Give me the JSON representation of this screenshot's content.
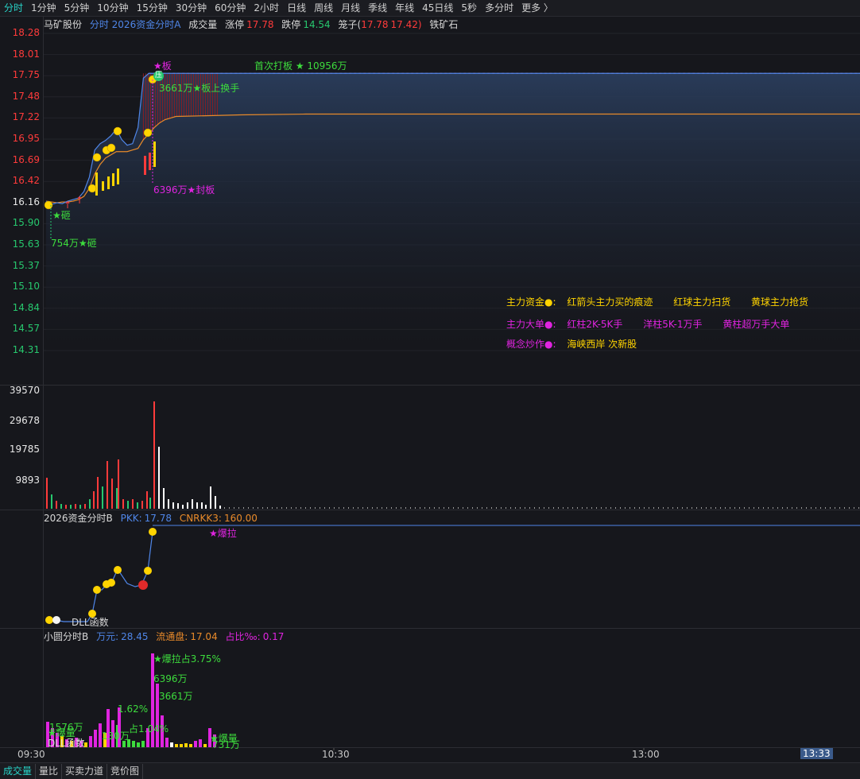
{
  "tabs": [
    "分时",
    "1分钟",
    "5分钟",
    "10分钟",
    "15分钟",
    "30分钟",
    "60分钟",
    "2小时",
    "日线",
    "周线",
    "月线",
    "季线",
    "年线",
    "45日线",
    "5秒",
    "多分时",
    "更多 〉"
  ],
  "active_tab": 0,
  "header": {
    "stock": "马矿股份",
    "indicator": "分时 2026资金分时A",
    "volume_label": "成交量",
    "limit_up_label": "涨停",
    "limit_up": "17.78",
    "limit_down_label": "跌停",
    "limit_down": "14.54",
    "cage_label": "笼子(",
    "cage_hi": "17.78",
    "cage_lo": "17.42)",
    "sector": "铁矿石"
  },
  "price_axis": [
    "18.28",
    "18.01",
    "17.75",
    "17.48",
    "17.22",
    "16.95",
    "16.69",
    "16.42",
    "16.16",
    "15.90",
    "15.63",
    "15.37",
    "15.10",
    "14.84",
    "14.57",
    "14.31"
  ],
  "volume_axis": [
    "39570",
    "29678",
    "19785",
    "9893"
  ],
  "indicator_b": {
    "name": "2026资金分时B",
    "pkk_label": "PKK:",
    "pkk": "17.78",
    "cnrkk_label": "CNRKK3:",
    "cnrkk": "160.00",
    "burst": "★爆拉",
    "func_label": "DLL函数"
  },
  "indicator_c": {
    "name": "小圆分时B",
    "wan_label": "万元:",
    "wan": "28.45",
    "float_label": "流通盘:",
    "float": "17.04",
    "ratio_label": "占比‰:",
    "ratio": "0.17",
    "ann_burst": "★爆拉占3.75%",
    "ann_6396": "6396万",
    "ann_3661": "3661万",
    "ann_162": "1.62%",
    "ann_pct104": "占1.04%",
    "ann_1576": "1576万",
    "ann_boom1": "★爆量",
    "ann_boom2": "★爆量",
    "ann_731": "731万",
    "ann_dll": "DLL函数",
    "ann_130": "130万"
  },
  "annotations": {
    "limit_star": "★板",
    "first_board": "首次打板 ★ 10956万",
    "turnover": "3661万★板上换手",
    "seal": "6396万★封板",
    "smash": "★砸",
    "smash_amt": "754万★砸",
    "badge": "压"
  },
  "legend": {
    "row1_title": "主力资金●:",
    "row1_items": [
      "红箭头主力买的痕迹",
      "红球主力扫货",
      "黄球主力抢货"
    ],
    "row2_title": "主力大单●:",
    "row2_items": [
      "红柱2K-5K手",
      "洋柱5K-1万手",
      "黄柱超万手大单"
    ],
    "row3_title": "概念炒作●:",
    "row3_items": [
      "海峡西岸 次新股"
    ]
  },
  "time_axis": [
    "09:30",
    "10:30",
    "13:00"
  ],
  "current_time": "13:33",
  "bottom_tabs": [
    "成交量",
    "量比",
    "买卖力道",
    "竞价图"
  ],
  "colors": {
    "up": "#ff3b3b",
    "down": "#27c86e",
    "price_line": "#4f86e8",
    "avg_line": "#e88a2a",
    "yellow": "#ffd400",
    "magenta": "#e024e0",
    "cyan": "#27d3c8"
  },
  "chart_data": {
    "type": "line",
    "ylim": [
      14.31,
      18.28
    ],
    "x_minutes_from_open": [
      0,
      5,
      10,
      15,
      20,
      25,
      30,
      35,
      40,
      45,
      50,
      55,
      60,
      65,
      70,
      75,
      80,
      85,
      90,
      95,
      100,
      105,
      110,
      115,
      120,
      180,
      240
    ],
    "series": [
      {
        "values": [
          16.18,
          16.14,
          16.16,
          16.15,
          16.18,
          16.2,
          16.22,
          16.3,
          16.48,
          16.82,
          16.9,
          16.94,
          17.0,
          17.08,
          16.95,
          16.88,
          16.9,
          17.1,
          17.72,
          17.78,
          17.78,
          17.78,
          17.78,
          17.78,
          17.78,
          17.78,
          17.78
        ]
      },
      {
        "values": [
          16.18,
          16.17,
          16.16,
          16.17,
          16.17,
          16.18,
          16.2,
          16.24,
          16.34,
          16.52,
          16.64,
          16.72,
          16.76,
          16.8,
          16.8,
          16.8,
          16.82,
          16.84,
          16.95,
          17.02,
          17.1,
          17.16,
          17.2,
          17.22,
          17.24,
          17.26,
          17.27
        ]
      }
    ]
  }
}
